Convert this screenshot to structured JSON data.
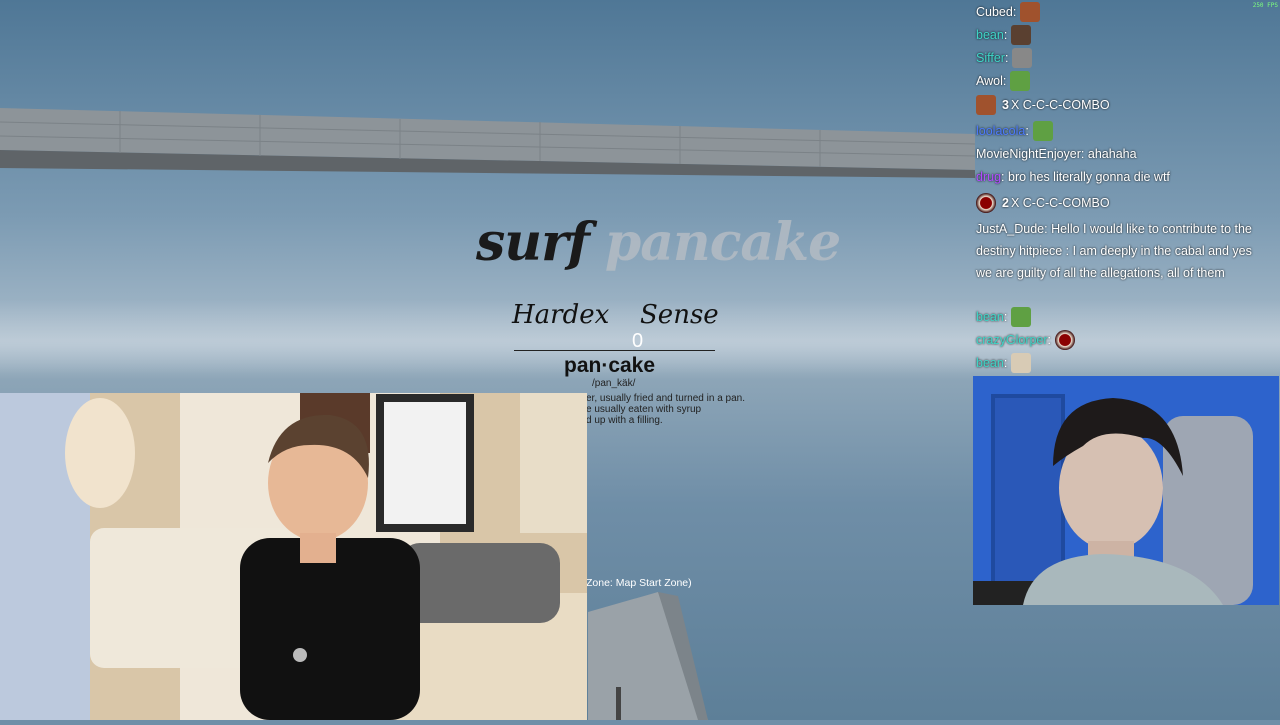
{
  "fps_counter": "250 FPS",
  "map": {
    "title_word_1": "surf",
    "title_word_2": "pancake",
    "author_1": "Hardex",
    "author_2": "Sense",
    "counter": "0",
    "dictionary": {
      "word": "pan·cake",
      "pronunciation": "/pan_käk/",
      "definition_lines": [
        "er, usually fried and turned in a pan.",
        "e usually eaten with syrup",
        "d up with a filling."
      ]
    },
    "zone_label": "Zone: Map Start Zone)"
  },
  "chat": {
    "messages": [
      {
        "user": "Cubed",
        "sep": ":",
        "text": "",
        "emote": "face-emote"
      },
      {
        "user": "bean",
        "sep": ":",
        "text": "",
        "emote": "portrait-emote"
      },
      {
        "user": "Siffer",
        "sep": ":",
        "text": "",
        "emote": "camera-emote"
      },
      {
        "user": "Awol",
        "sep": ":",
        "text": "",
        "emote": "frog-emote"
      },
      {
        "combo_count": "3",
        "combo_text": "X C-C-C-COMBO",
        "emote": "face-emote"
      },
      {
        "user": "loolacola",
        "sep": ":",
        "text": "",
        "emote": "frog-emote"
      },
      {
        "user": "MovieNightEnjoyer",
        "sep": ":",
        "text": "ahahaha"
      },
      {
        "user": "drug",
        "sep": ":",
        "text": "bro hes literally gonna die wtf"
      },
      {
        "combo_count": "2",
        "combo_text": "X C-C-C-COMBO",
        "emote": "red-orb-emote"
      },
      {
        "user": "JustA_Dude",
        "sep": ":",
        "text": "Hello I would like to contribute to the destiny hitpiece : I am deeply in the cabal and yes we are guilty of all the allegations, all of them"
      },
      {
        "user": "bean",
        "sep": ":",
        "text": "",
        "emote": "frog-emote"
      },
      {
        "user": "crazyGlorper",
        "sep": ":",
        "text": "",
        "emote": "red-orb-emote"
      },
      {
        "user": "bean",
        "sep": ":",
        "text": "",
        "emote": "hand-emote"
      }
    ]
  },
  "colors": {
    "chat_name_teal": "#3fd6c8",
    "chat_name_blue": "#4c7bff",
    "chat_name_purple": "#b24cff",
    "fps_green": "#7dff7d"
  }
}
